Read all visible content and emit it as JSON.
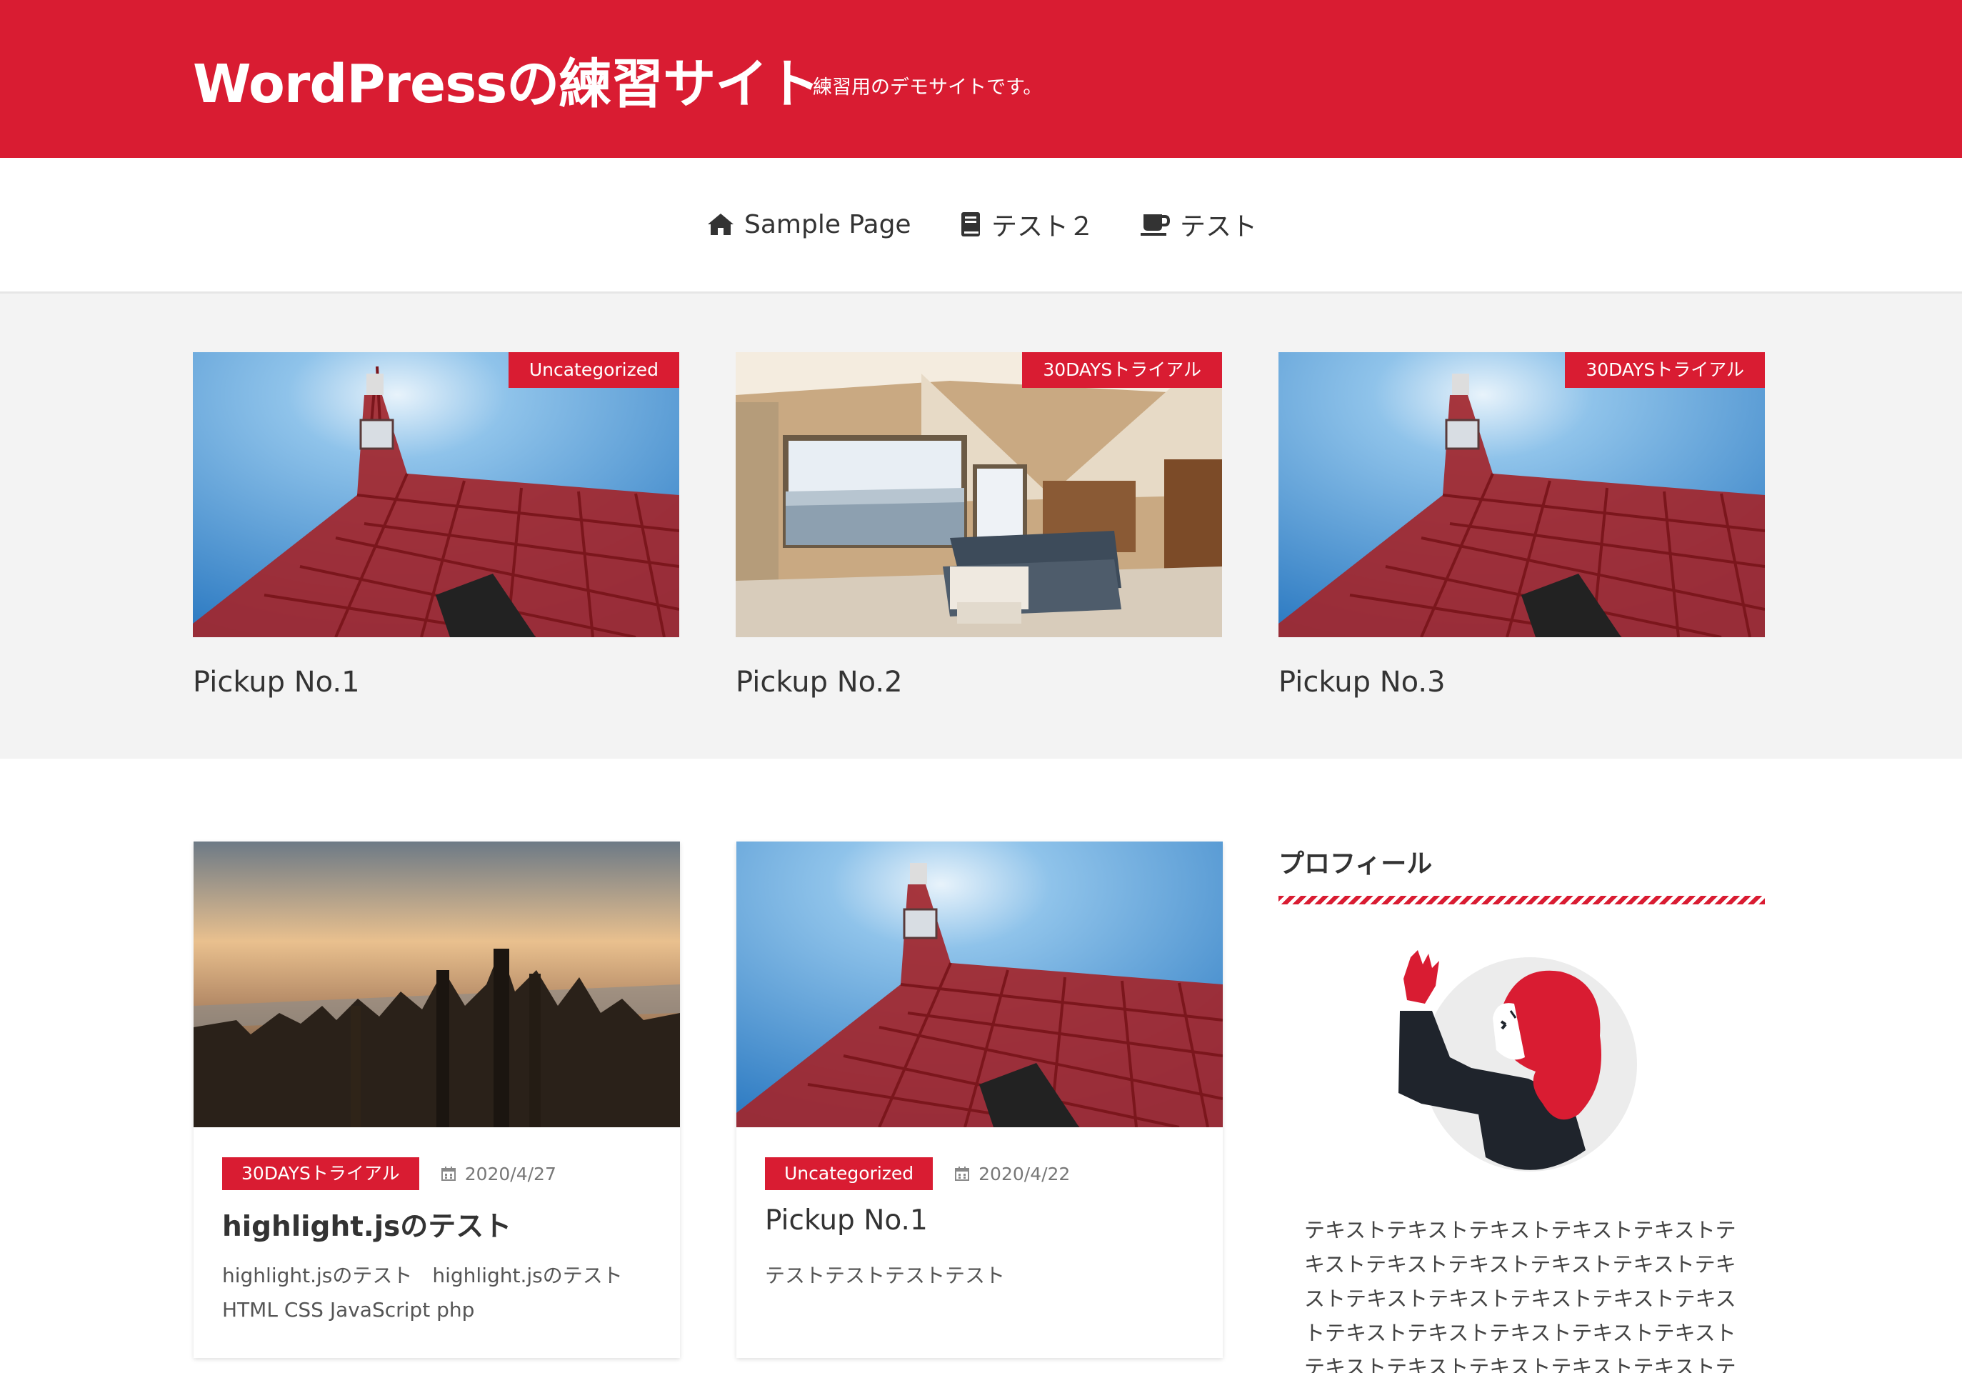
{
  "header": {
    "site_title": "WordPressの練習サイト",
    "description": "練習用のデモサイトです。",
    "brand_color": "#d91c32"
  },
  "nav": {
    "items": [
      {
        "label": "Sample Page",
        "icon": "home-icon"
      },
      {
        "label": "テスト２",
        "icon": "book-icon"
      },
      {
        "label": "テスト",
        "icon": "coffee-icon"
      }
    ]
  },
  "pickup": {
    "cards": [
      {
        "category": "Uncategorized",
        "title": "Pickup No.1",
        "image": "tokyo-tower"
      },
      {
        "category": "30DAYSトライアル",
        "title": "Pickup No.2",
        "image": "living-room"
      },
      {
        "category": "30DAYSトライアル",
        "title": "Pickup No.3",
        "image": "tokyo-tower"
      }
    ]
  },
  "posts": [
    {
      "category": "30DAYSトライアル",
      "date": "2020/4/27",
      "title": "highlight.jsのテスト",
      "excerpt": "highlight.jsのテスト　highlight.jsのテスト HTML CSS JavaScript php",
      "image": "city-skyline"
    },
    {
      "category": "Uncategorized",
      "date": "2020/4/22",
      "title": "Pickup No.1",
      "excerpt": "テストテストテストテスト",
      "image": "tokyo-tower"
    }
  ],
  "sidebar": {
    "title": "プロフィール",
    "profile_text": "テキストテキストテキストテキストテキストテキストテキストテキストテキストテキストテキストテキストテキストテキストテキストテキストテキストテキストテキストテキストテキストテキストテキストテキストテキストテキストテキストテキストテキストテキスト"
  }
}
